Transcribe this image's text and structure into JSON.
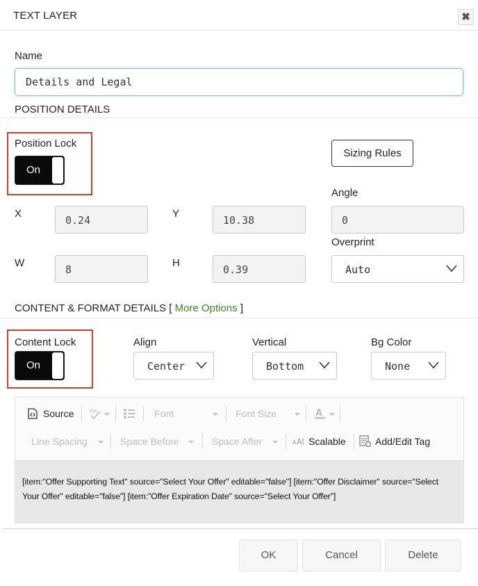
{
  "dialog": {
    "title": "TEXT LAYER",
    "close_symbol": "✖"
  },
  "name": {
    "label": "Name",
    "value": "Details and Legal"
  },
  "position": {
    "section_title": "POSITION DETAILS",
    "lock_label": "Position Lock",
    "lock_state": "On",
    "sizing_rules_label": "Sizing Rules",
    "x_label": "X",
    "x_value": "0.24",
    "y_label": "Y",
    "y_value": "10.38",
    "w_label": "W",
    "w_value": "8",
    "h_label": "H",
    "h_value": "0.39",
    "angle_label": "Angle",
    "angle_value": "0",
    "overprint_label": "Overprint",
    "overprint_value": "Auto"
  },
  "content": {
    "section_title": "CONTENT & FORMAT DETAILS [",
    "more_options": "More Options",
    "section_close": "]",
    "lock_label": "Content Lock",
    "lock_state": "On",
    "align_label": "Align",
    "align_value": "Center",
    "vertical_label": "Vertical",
    "vertical_value": "Bottom",
    "bgcolor_label": "Bg Color",
    "bgcolor_value": "None"
  },
  "toolbar": {
    "source": "Source",
    "font": "Font",
    "font_size": "Font Size",
    "line_spacing": "Line Spacing",
    "space_before": "Space Before",
    "space_after": "Space After",
    "scalable": "Scalable",
    "add_edit_tag": "Add/Edit Tag"
  },
  "editor_text": "[item:\"Offer Supporting Text\" source=\"Select Your Offer\" editable=\"false\"] [item:\"Offer Disclaimer\" source=\"Select Your Offer\" editable=\"false\"] [item:\"Offer Expiration Date\" source=\"Select Your Offer\"]",
  "footer": {
    "ok": "OK",
    "cancel": "Cancel",
    "delete": "Delete"
  },
  "colors": {
    "highlight_border": "#d0402f",
    "link_green": "#3a8a1f",
    "toggle_bg": "#0a0a0a",
    "input_focus": "#86b7e8"
  },
  "icons": [
    "close-icon",
    "source-icon",
    "spellcheck-icon",
    "bulleted-list-icon",
    "font-color-icon",
    "scalable-icon",
    "add-edit-tag-icon",
    "chevron-down-icon"
  ]
}
